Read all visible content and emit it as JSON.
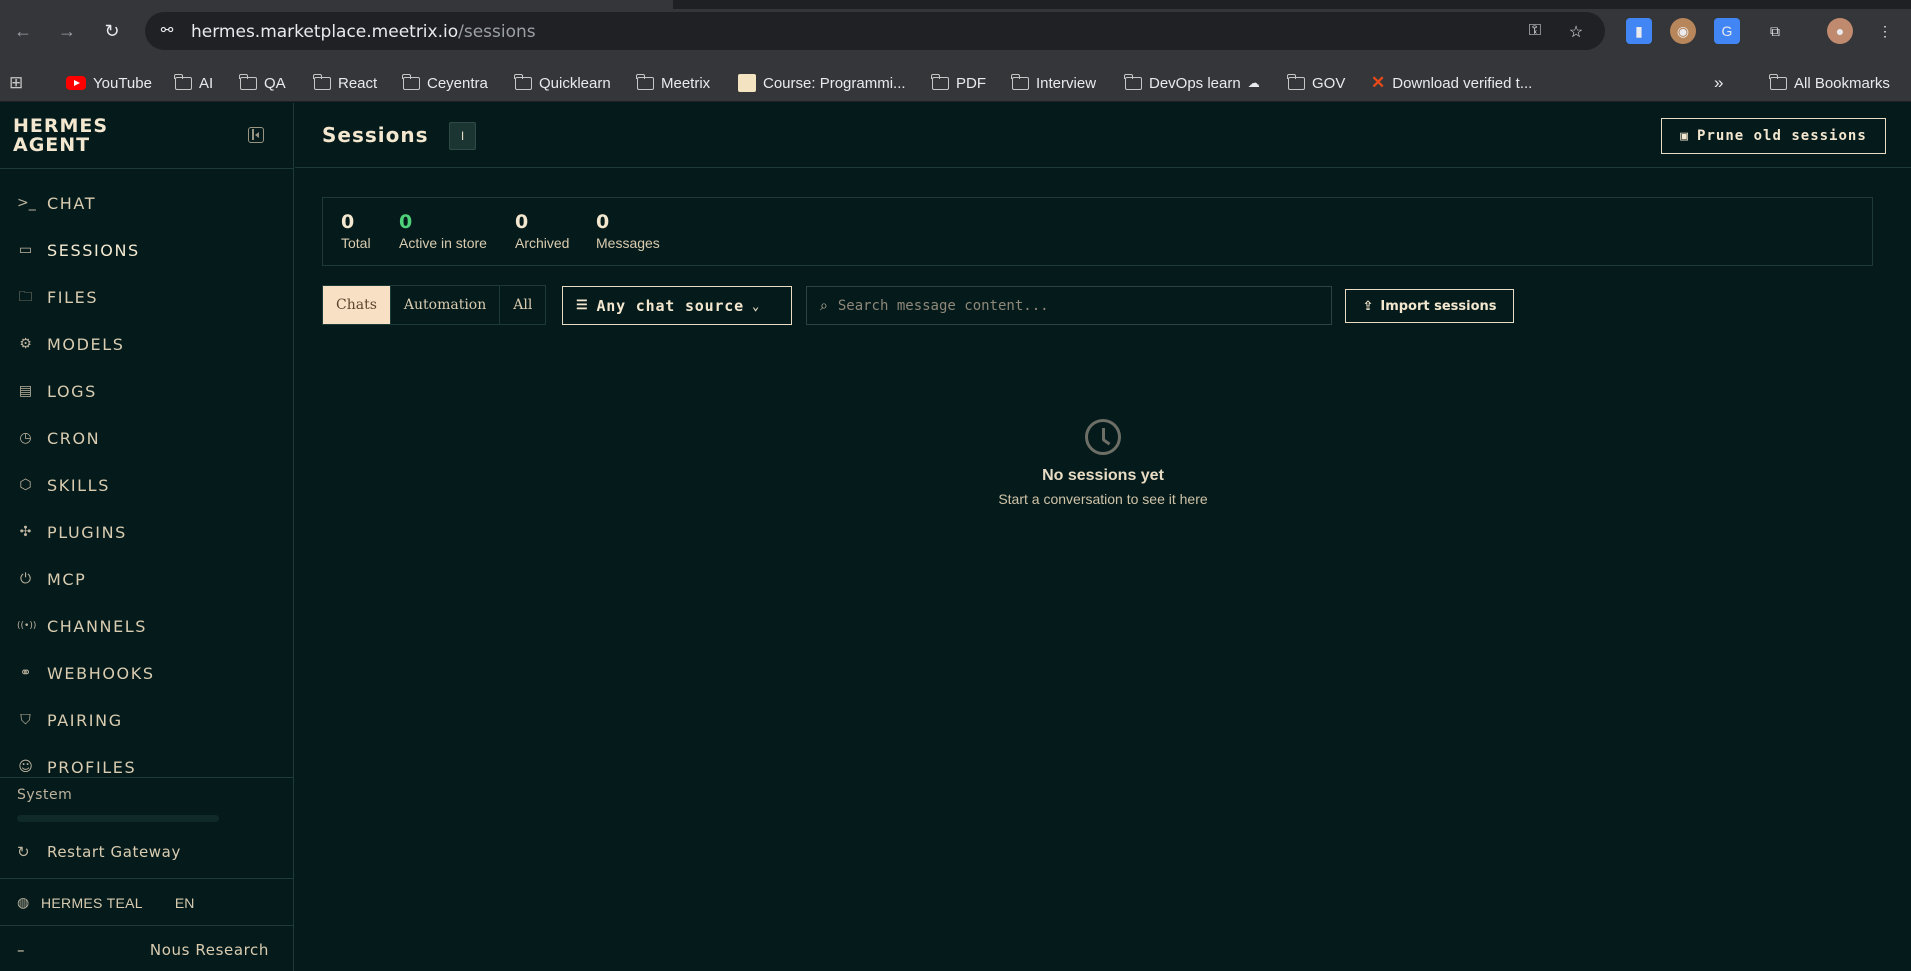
{
  "browser": {
    "url_host": "hermes.marketplace.meetrix.io",
    "url_path": "/sessions",
    "bookmarks": [
      "YouTube",
      "AI",
      "QA",
      "React",
      "Ceyentra",
      "Quicklearn",
      "Meetrix",
      "Course: Programmi...",
      "PDF",
      "Interview",
      "DevOps learn",
      "GOV",
      "Download verified t..."
    ],
    "all_bookmarks": "All Bookmarks",
    "overflow": "»"
  },
  "sidebar": {
    "brand_line1": "HERMES",
    "brand_line2": "AGENT",
    "items": [
      {
        "label": "CHAT",
        "icon": ">_"
      },
      {
        "label": "SESSIONS",
        "icon": "▭"
      },
      {
        "label": "FILES",
        "icon": "🗀"
      },
      {
        "label": "MODELS",
        "icon": "⚙"
      },
      {
        "label": "LOGS",
        "icon": "▤"
      },
      {
        "label": "CRON",
        "icon": "◷"
      },
      {
        "label": "SKILLS",
        "icon": "⬡"
      },
      {
        "label": "PLUGINS",
        "icon": "✣"
      },
      {
        "label": "MCP",
        "icon": "⏻"
      },
      {
        "label": "CHANNELS",
        "icon": "((•))"
      },
      {
        "label": "WEBHOOKS",
        "icon": "⚭"
      },
      {
        "label": "PAIRING",
        "icon": "⛉"
      },
      {
        "label": "PROFILES",
        "icon": "☺"
      }
    ],
    "system_label": "System",
    "restart_label": "Restart Gateway",
    "theme_label": "HERMES TEAL",
    "language": "EN",
    "footer_dash": "–",
    "footer_brand": "Nous Research"
  },
  "header": {
    "title": "Sessions",
    "badge": "I",
    "prune_label": "Prune old sessions"
  },
  "stats": [
    {
      "value": "0",
      "caption": "Total"
    },
    {
      "value": "0",
      "caption": "Active in store"
    },
    {
      "value": "0",
      "caption": "Archived"
    },
    {
      "value": "0",
      "caption": "Messages"
    }
  ],
  "filters": {
    "tabs": [
      "Chats",
      "Automation",
      "All"
    ],
    "source_label": "Any chat source",
    "search_placeholder": "Search message content...",
    "import_label": "Import sessions"
  },
  "empty": {
    "title": "No sessions yet",
    "subtitle": "Start a conversation to see it here"
  },
  "colors": {
    "background": "#051a1b",
    "accent": "#f8e0c4",
    "active_green": "#4fd17a"
  }
}
